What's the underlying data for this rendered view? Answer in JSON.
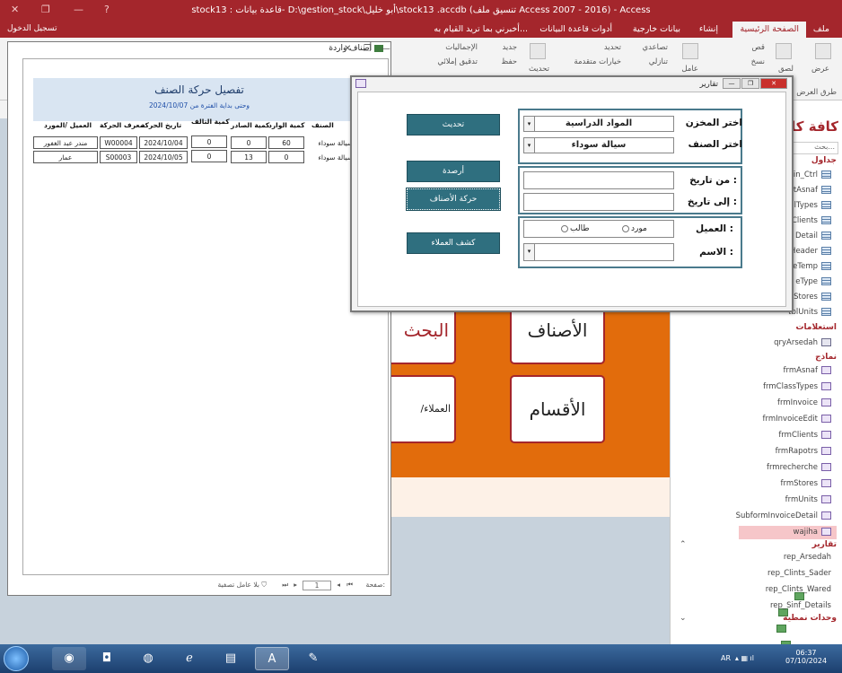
{
  "window": {
    "title": "stock13 : قاعدة بيانات- D:\\gestion_stock\\أبو خليل\\stock13 .accdb (تنسيق ملف Access 2007 - 2016) - Access",
    "signin": "تسجيل الدخول"
  },
  "ribbon_tabs": [
    "ملف",
    "الصفحة الرئيسية",
    "إنشاء",
    "بيانات خارجية",
    "أدوات قاعدة البيانات",
    "أخبرني بما تريد القيام به..."
  ],
  "ribbon": {
    "view": "عرض",
    "paste": "لصق",
    "cut": "قص",
    "copy": "نسخ",
    "filter": "عامل",
    "asc": "تصاعدي",
    "desc": "تنازلي",
    "refresh": "تحديث",
    "new": "جديد",
    "save": "حفظ",
    "totals": "الإجماليات",
    "spelling": "تدقيق إملائي",
    "advanced": "خيارات متقدمة",
    "select": "تحديد",
    "views_group": "طرق العرض"
  },
  "nav": {
    "header": "كافة كا",
    "search": "بحث...",
    "sections": {
      "tables": "جداول",
      "queries": "استعلامات",
      "forms": "نماذج",
      "reports": "تقارير",
      "modules": "وحدات نمطية"
    },
    "tables": [
      "in_Ctrl",
      "tAsnaf",
      "lTypes",
      "Clients",
      "Detail",
      "Header",
      "eTemp",
      "eType",
      "Stores",
      "tblUnits"
    ],
    "queries": [
      "qryArsedah"
    ],
    "forms": [
      "frmAsnaf",
      "frmClassTypes",
      "frmInvoice",
      "frmInvoiceEdit",
      "frmClients",
      "frmRapotrs",
      "frmrecherche",
      "frmStores",
      "frmUnits",
      "SubformInvoiceDetail",
      "wajiha"
    ],
    "reports": [
      "rep_Arsedah",
      "rep_Clints_Sader",
      "rep_Clints_Wared",
      "rep_Sinf_Details"
    ]
  },
  "mainform": {
    "btn_items": "الأصناف",
    "btn_search": "البحث",
    "btn_sections": "الأقسام",
    "btn_clients": "العملاء/الموردين"
  },
  "report": {
    "window_title": "أصناف واردة",
    "title": "تفصيل حركة الصنف",
    "subtitle_from": "من",
    "subtitle_start": "بداية الفترة",
    "subtitle_to": "وحتى",
    "subtitle_date": "2024/10/07",
    "columns": [
      "الصنف",
      "كمية الوارد",
      "كمية الصادر",
      "كمية التالف",
      "تاريخ الحركة",
      "معرف الحركة",
      "العميل /المورد"
    ],
    "rows": [
      [
        "سيالة سوداء",
        "60",
        "0",
        "0",
        "2024/10/04",
        "W00004",
        "مندر عبد الغفور"
      ],
      [
        "سيالة سوداء",
        "0",
        "13",
        "0",
        "2024/10/05",
        "S00003",
        "عمار"
      ]
    ],
    "nav_page_label": "صفحة:",
    "nav_page": "1",
    "nav_filter": "بلا عامل تصفية"
  },
  "dialog": {
    "title": "تقارير",
    "store_label": "اختر المخزن",
    "store_value": "المواد الدراسية",
    "item_label": "اختر الصنف",
    "item_value": "سيالة سوداء",
    "from_label": "من تاريخ :",
    "to_label": "إلى تاريخ :",
    "client_label": "العميل :",
    "radio_supplier": "مورد",
    "radio_student": "طالب",
    "name_label": "الاسم :",
    "btn_refresh": "تحديث",
    "btn_balances": "أرصدة",
    "btn_movement": "حركة الأصناف",
    "btn_clients": "كشف العملاء"
  },
  "taskbar": {
    "lang": "AR",
    "time": "06:37",
    "date": "07/10/2024"
  }
}
